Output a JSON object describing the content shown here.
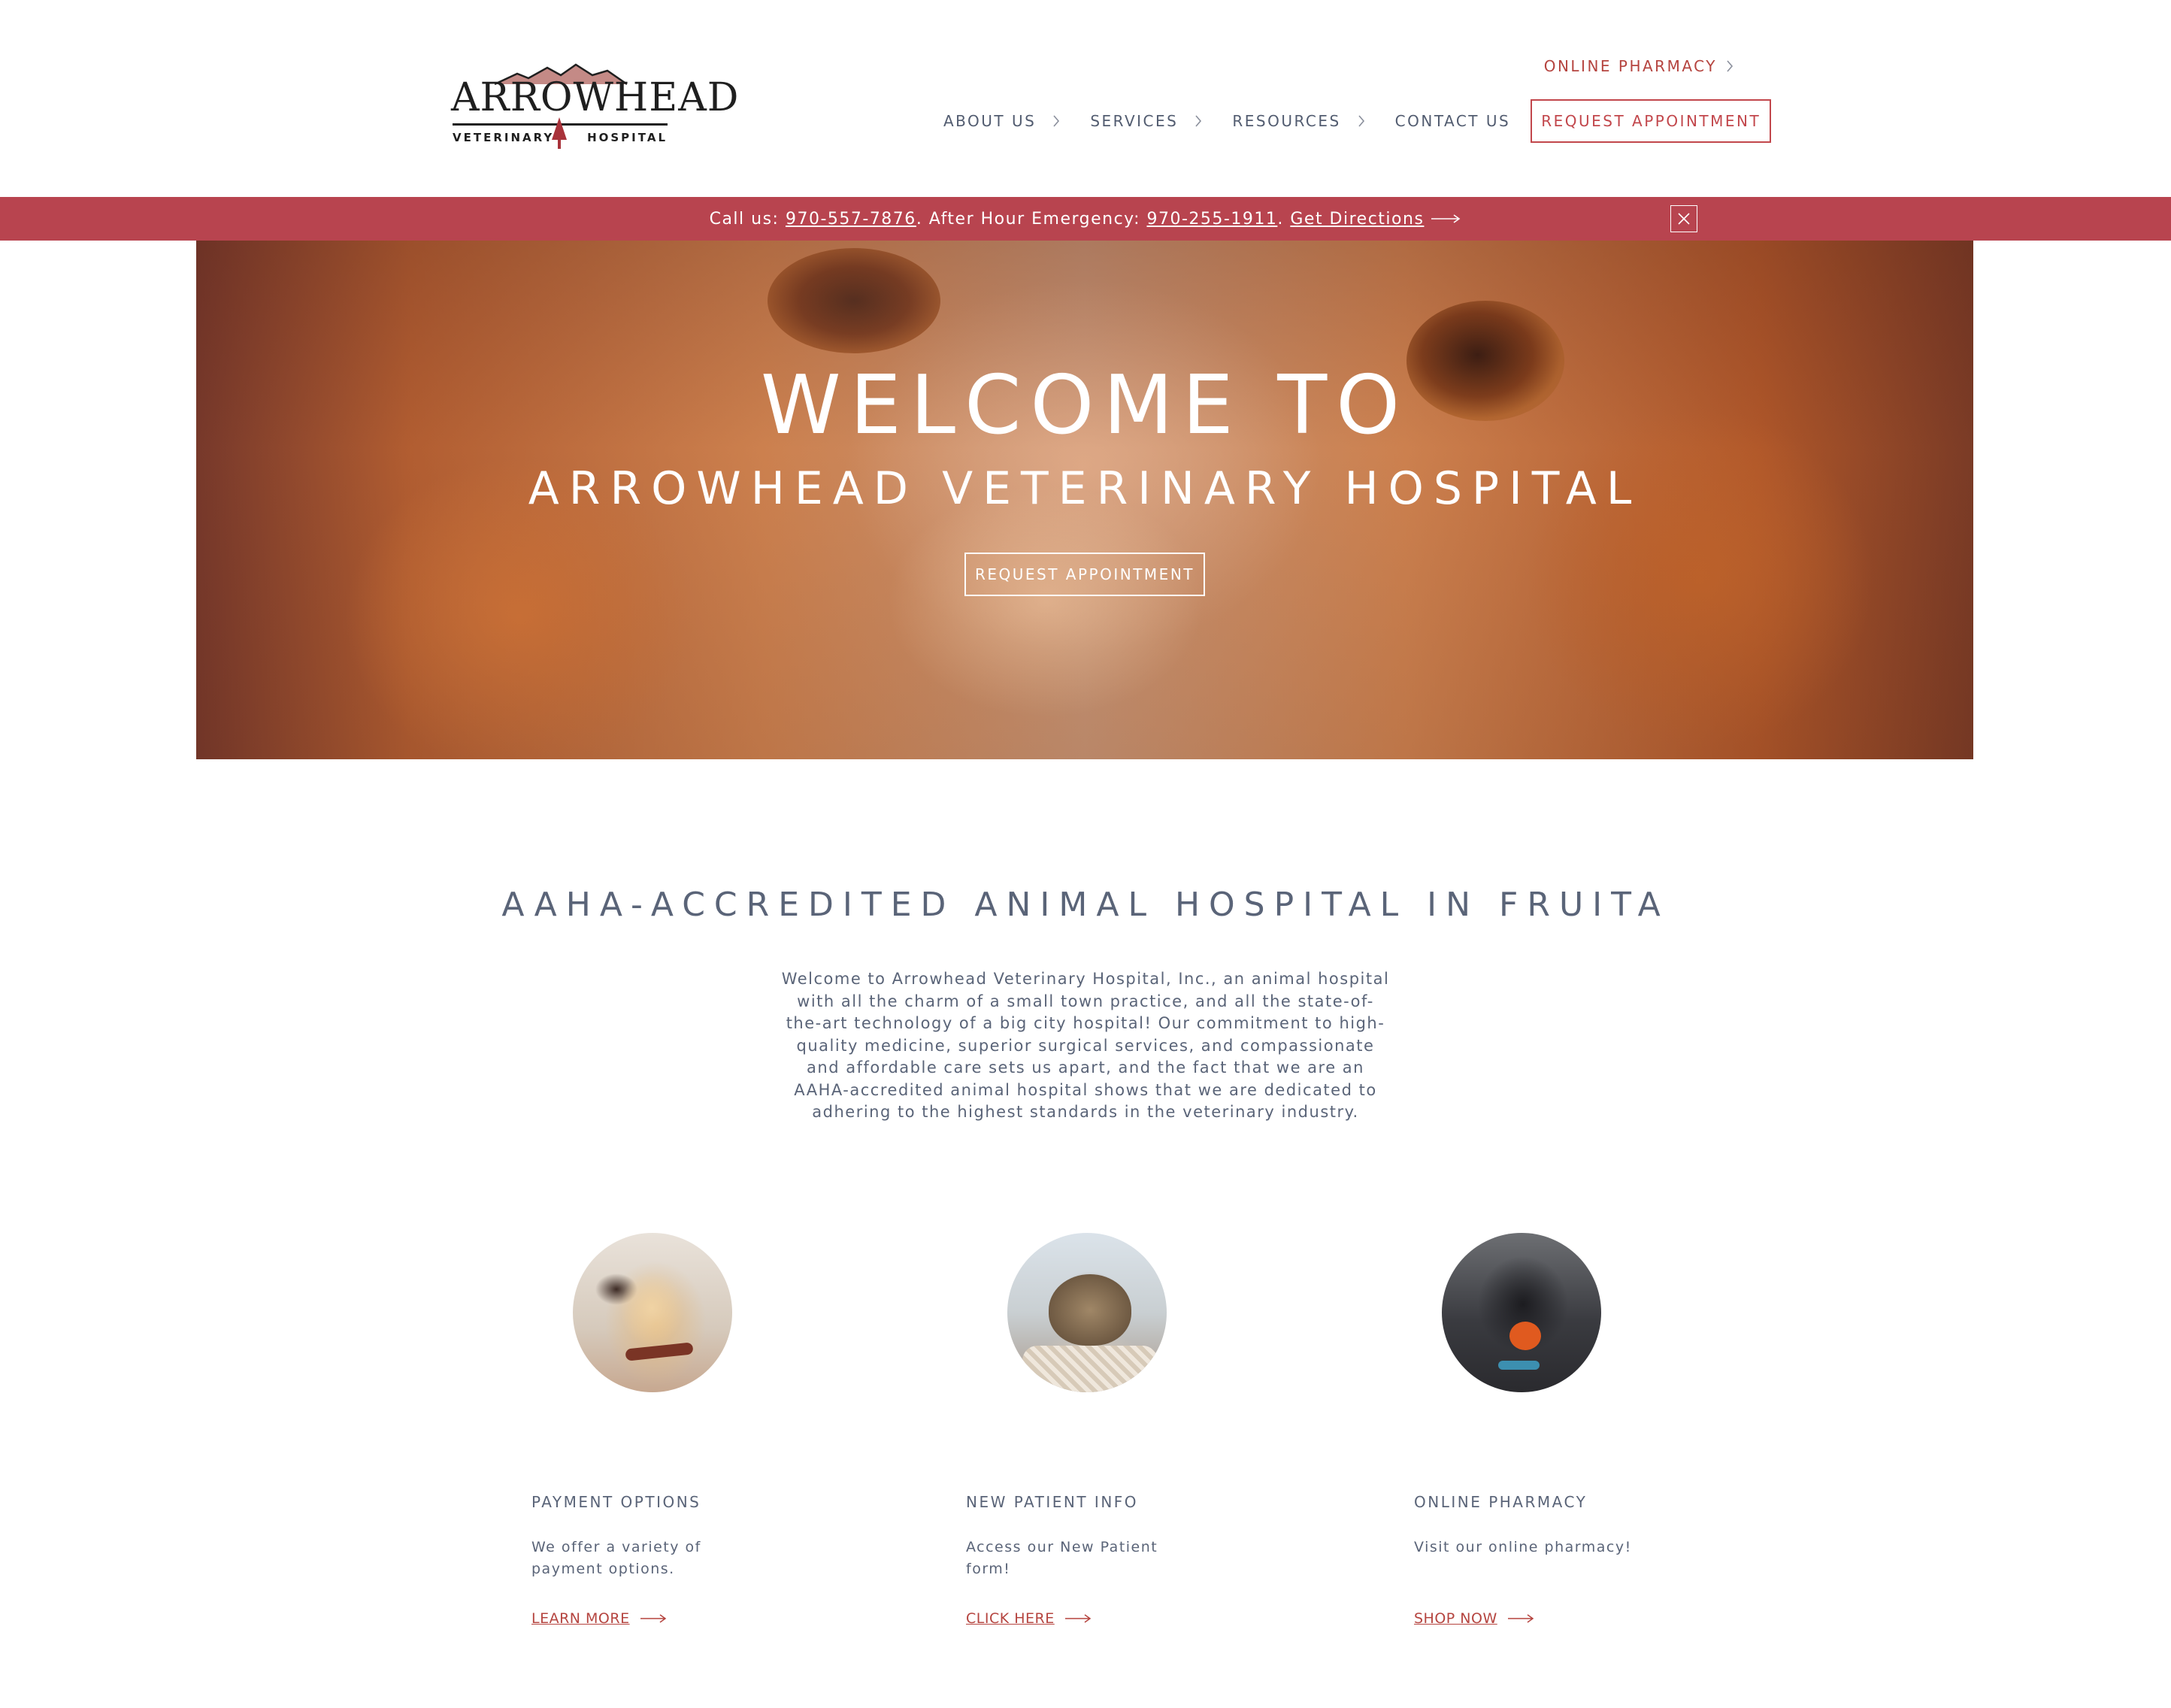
{
  "header": {
    "logo": {
      "wordmark": "ARROWHEAD",
      "subline_left": "VETERINARY",
      "subline_right": "HOSPITAL"
    },
    "top_link": "ONLINE PHARMACY",
    "nav": [
      {
        "label": "ABOUT US"
      },
      {
        "label": "SERVICES"
      },
      {
        "label": "RESOURCES"
      },
      {
        "label": "CONTACT US"
      }
    ],
    "cta": "REQUEST APPOINTMENT"
  },
  "announcement": {
    "call_prefix": "Call us: ",
    "phone": "970-557-7876",
    "emergency_prefix": ". After Hour Emergency: ",
    "emergency_phone": "970-255-1911",
    "separator": ". ",
    "directions": "Get Directions"
  },
  "hero": {
    "title": "WELCOME TO",
    "subtitle": "ARROWHEAD VETERINARY HOSPITAL",
    "button": "REQUEST APPOINTMENT"
  },
  "intro": {
    "heading": "AAHA-ACCREDITED ANIMAL HOSPITAL IN FRUITA",
    "lines": [
      "Welcome to Arrowhead Veterinary Hospital, Inc., an animal hospital",
      "with all the charm of a small town practice, and all the state-of-",
      "the-art technology of a big city hospital! Our commitment to high-",
      "quality medicine, superior surgical services, and compassionate",
      "and affordable care sets us apart, and the fact that we are an",
      "AAHA-accredited animal hospital shows that we are dedicated to",
      "adhering to the highest standards in the veterinary industry."
    ]
  },
  "cards": [
    {
      "title": "PAYMENT OPTIONS",
      "desc_line1": "We offer a variety of",
      "desc_line2": "payment options.",
      "link": "LEARN MORE"
    },
    {
      "title": "NEW PATIENT INFO",
      "desc_line1": "Access our New Patient",
      "desc_line2": "form!",
      "link": "CLICK HERE"
    },
    {
      "title": "ONLINE PHARMACY",
      "desc_line1": "Visit our online pharmacy!",
      "desc_line2": "",
      "link": "SHOP NOW"
    }
  ],
  "colors": {
    "brand_red": "#b8444f",
    "link_red": "#b5443f",
    "text_slate": "#5a6478"
  }
}
